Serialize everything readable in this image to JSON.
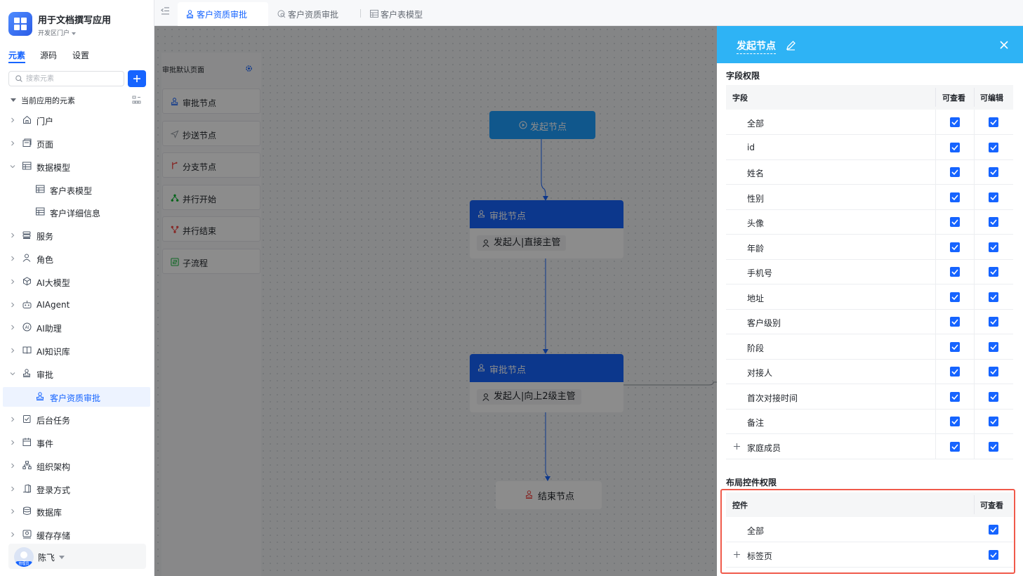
{
  "app": {
    "title": "用于文档撰写应用",
    "subtitle": "开发区门户"
  },
  "sidebar": {
    "tabs": [
      "元素",
      "源码",
      "设置"
    ],
    "search_placeholder": "搜索元素",
    "section_label": "当前应用的元素",
    "items": [
      {
        "label": "门户",
        "icon": "home-icon"
      },
      {
        "label": "页面",
        "icon": "page-icon"
      },
      {
        "label": "数据模型",
        "icon": "table-icon"
      },
      {
        "label": "客户表模型",
        "icon": "table-icon"
      },
      {
        "label": "客户详细信息",
        "icon": "table-icon"
      },
      {
        "label": "服务",
        "icon": "service-icon"
      },
      {
        "label": "角色",
        "icon": "role-icon"
      },
      {
        "label": "AI大模型",
        "icon": "model-icon"
      },
      {
        "label": "AIAgent",
        "icon": "robot-icon"
      },
      {
        "label": "AI助理",
        "icon": "ai-icon"
      },
      {
        "label": "AI知识库",
        "icon": "book-icon"
      },
      {
        "label": "审批",
        "icon": "stamp-icon"
      },
      {
        "label": "客户资质审批",
        "icon": "stamp-icon"
      },
      {
        "label": "后台任务",
        "icon": "task-icon"
      },
      {
        "label": "事件",
        "icon": "event-icon"
      },
      {
        "label": "组织架构",
        "icon": "org-icon"
      },
      {
        "label": "登录方式",
        "icon": "login-icon"
      },
      {
        "label": "数据库",
        "icon": "database-icon"
      },
      {
        "label": "缓存存储",
        "icon": "cache-icon"
      }
    ],
    "user": {
      "name": "陈飞",
      "badge": "管理员"
    }
  },
  "tabs": [
    {
      "label": "客户资质审批",
      "icon": "stamp-icon"
    },
    {
      "label": "客户资质审批",
      "icon": "search-doc-icon"
    },
    {
      "label": "客户表模型",
      "icon": "table-icon"
    }
  ],
  "node_panel": {
    "title": "审批默认页面",
    "items": [
      {
        "label": "审批节点",
        "icon": "stamp-icon",
        "color": "#1664ff"
      },
      {
        "label": "抄送节点",
        "icon": "send-icon",
        "color": "#8f959e"
      },
      {
        "label": "分支节点",
        "icon": "branch-icon",
        "color": "#f54a45"
      },
      {
        "label": "并行开始",
        "icon": "parallel-start-icon",
        "color": "#00b42a"
      },
      {
        "label": "并行结束",
        "icon": "parallel-end-icon",
        "color": "#f54a45"
      },
      {
        "label": "子流程",
        "icon": "subflow-icon",
        "color": "#00b42a"
      }
    ]
  },
  "flow": {
    "start": "发起节点",
    "approvals": [
      {
        "title": "审批节点",
        "assignee": "发起人|直接主管"
      },
      {
        "title": "审批节点",
        "assignee": "发起人|向上2级主管"
      }
    ],
    "end": "结束节点"
  },
  "drawer": {
    "title": "发起节点",
    "field_section": "字段权限",
    "field_headers": [
      "字段",
      "可查看",
      "可编辑"
    ],
    "fields": [
      {
        "name": "全部",
        "view": true,
        "edit": true
      },
      {
        "name": "id",
        "view": true,
        "edit": true
      },
      {
        "name": "姓名",
        "view": true,
        "edit": true
      },
      {
        "name": "性别",
        "view": true,
        "edit": true
      },
      {
        "name": "头像",
        "view": true,
        "edit": true
      },
      {
        "name": "年龄",
        "view": true,
        "edit": true
      },
      {
        "name": "手机号",
        "view": true,
        "edit": true
      },
      {
        "name": "地址",
        "view": true,
        "edit": true
      },
      {
        "name": "客户级别",
        "view": true,
        "edit": true
      },
      {
        "name": "阶段",
        "view": true,
        "edit": true
      },
      {
        "name": "对接人",
        "view": true,
        "edit": true
      },
      {
        "name": "首次对接时间",
        "view": true,
        "edit": true
      },
      {
        "name": "备注",
        "view": true,
        "edit": true
      },
      {
        "name": "家庭成员",
        "view": true,
        "edit": true,
        "expandable": true
      }
    ],
    "layout_section": "布局控件权限",
    "layout_headers": [
      "控件",
      "可查看"
    ],
    "controls": [
      {
        "name": "全部",
        "view": true
      },
      {
        "name": "标签页",
        "view": true,
        "expandable": true
      }
    ]
  },
  "colors": {
    "primary": "#1664ff",
    "drawer_header": "#2eb3f5",
    "highlight": "#f05a4b"
  }
}
